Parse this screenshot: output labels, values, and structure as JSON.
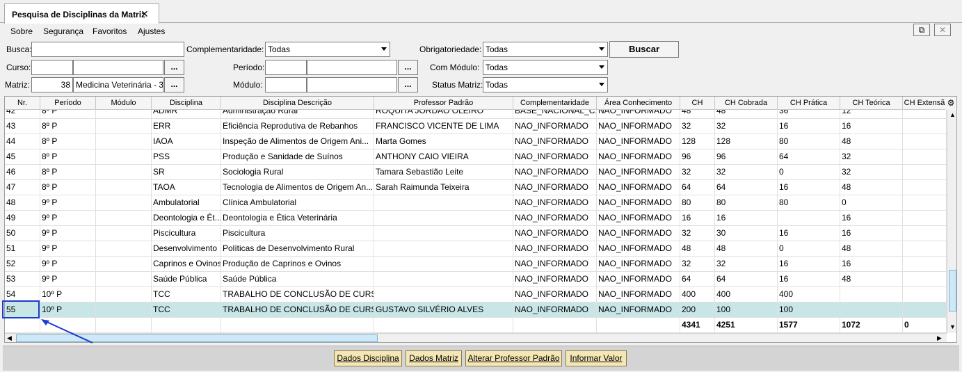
{
  "tab": {
    "title": "Pesquisa de Disciplinas da Matriz",
    "close": "✕"
  },
  "menu": [
    "Sobre",
    "Segurança",
    "Favoritos",
    "Ajustes"
  ],
  "window_buttons": {
    "popout": "⧉",
    "close": "✕"
  },
  "filters": {
    "busca_label": "Busca:",
    "busca_value": "",
    "complementaridade_label": "Complementaridade:",
    "complementaridade_value": "Todas",
    "obrigatoriedade_label": "Obrigatoriedade:",
    "obrigatoriedade_value": "Todas",
    "buscar_label": "Buscar",
    "curso_label": "Curso:",
    "curso_code": "",
    "curso_name": "",
    "periodo_label": "Período:",
    "periodo_code": "",
    "periodo_name": "",
    "com_modulo_label": "Com Módulo:",
    "com_modulo_value": "Todas",
    "matriz_label": "Matriz:",
    "matriz_code": "38",
    "matriz_name": "Medicina Veterinária - 3",
    "modulo_label": "Módulo:",
    "modulo_code": "",
    "modulo_name": "",
    "status_matriz_label": "Status Matriz:",
    "status_matriz_value": "Todas",
    "dots": "..."
  },
  "columns": [
    "Nr.",
    "Período",
    "Módulo",
    "Disciplina",
    "Disciplina Descrição",
    "Professor Padrão",
    "Complementaridade",
    "Área Conhecimento",
    "CH",
    "CH Cobrada",
    "CH Prática",
    "CH Teórica",
    "CH Extensã"
  ],
  "partial_row": [
    "42",
    "8º P",
    "",
    "ADMR",
    "Administração Rural",
    "ROQUITA JORDÃO OLEIRO",
    "BASE_NACIONAL_C...",
    "NAO_INFORMADO",
    "48",
    "48",
    "36",
    "12",
    ""
  ],
  "rows": [
    [
      "43",
      "8º P",
      "",
      "ERR",
      "Eficiência Reprodutiva de Rebanhos",
      "FRANCISCO VICENTE DE LIMA",
      "NAO_INFORMADO",
      "NAO_INFORMADO",
      "32",
      "32",
      "16",
      "16",
      ""
    ],
    [
      "44",
      "8º P",
      "",
      "IAOA",
      "Inspeção de Alimentos de Origem Ani...",
      "Marta Gomes",
      "NAO_INFORMADO",
      "NAO_INFORMADO",
      "128",
      "128",
      "80",
      "48",
      ""
    ],
    [
      "45",
      "8º P",
      "",
      "PSS",
      "Produção e Sanidade de Suínos",
      "ANTHONY CAIO VIEIRA",
      "NAO_INFORMADO",
      "NAO_INFORMADO",
      "96",
      "96",
      "64",
      "32",
      ""
    ],
    [
      "46",
      "8º P",
      "",
      "SR",
      "Sociologia Rural",
      "Tamara Sebastião Leite",
      "NAO_INFORMADO",
      "NAO_INFORMADO",
      "32",
      "32",
      "0",
      "32",
      ""
    ],
    [
      "47",
      "8º P",
      "",
      "TAOA",
      "Tecnologia de Alimentos de Origem An...",
      "Sarah Raimunda Teixeira",
      "NAO_INFORMADO",
      "NAO_INFORMADO",
      "64",
      "64",
      "16",
      "48",
      ""
    ],
    [
      "48",
      "9º P",
      "",
      "Ambulatorial",
      "Clínica Ambulatorial",
      "",
      "NAO_INFORMADO",
      "NAO_INFORMADO",
      "80",
      "80",
      "80",
      "0",
      ""
    ],
    [
      "49",
      "9º P",
      "",
      "Deontologia e Ét...",
      "Deontologia e Ética Veterinária",
      "",
      "NAO_INFORMADO",
      "NAO_INFORMADO",
      "16",
      "16",
      "",
      "16",
      ""
    ],
    [
      "50",
      "9º P",
      "",
      "Piscicultura",
      "Piscicultura",
      "",
      "NAO_INFORMADO",
      "NAO_INFORMADO",
      "32",
      "30",
      "16",
      "16",
      ""
    ],
    [
      "51",
      "9º P",
      "",
      "Desenvolvimento",
      "Políticas de Desenvolvimento Rural",
      "",
      "NAO_INFORMADO",
      "NAO_INFORMADO",
      "48",
      "48",
      "0",
      "48",
      ""
    ],
    [
      "52",
      "9º P",
      "",
      "Caprinos e Ovinos",
      "Produção de Caprinos e Ovinos",
      "",
      "NAO_INFORMADO",
      "NAO_INFORMADO",
      "32",
      "32",
      "16",
      "16",
      ""
    ],
    [
      "53",
      "9º P",
      "",
      "Saúde Pública",
      "Saúde Pública",
      "",
      "NAO_INFORMADO",
      "NAO_INFORMADO",
      "64",
      "64",
      "16",
      "48",
      ""
    ],
    [
      "54",
      "10º P",
      "",
      "TCC",
      "TRABALHO DE CONCLUSÃO DE CURSO",
      "",
      "NAO_INFORMADO",
      "NAO_INFORMADO",
      "400",
      "400",
      "400",
      "",
      ""
    ],
    [
      "55",
      "10º P",
      "",
      "TCC",
      "TRABALHO DE CONCLUSÃO DE CURSO",
      "GUSTAVO SILVÉRIO ALVES",
      "NAO_INFORMADO",
      "NAO_INFORMADO",
      "200",
      "100",
      "100",
      "",
      ""
    ]
  ],
  "totals": [
    "",
    "",
    "",
    "",
    "",
    "",
    "",
    "",
    "4341",
    "4251",
    "1577",
    "1072",
    "0"
  ],
  "buttons": [
    "Dados Disciplina",
    "Dados Matriz",
    "Alterar Professor Padrão",
    "Informar Valor"
  ],
  "colors": {
    "selected_row": "#c8e6e6",
    "button_bg": "#f5e6b6",
    "annotation": "#1a3ccf"
  }
}
